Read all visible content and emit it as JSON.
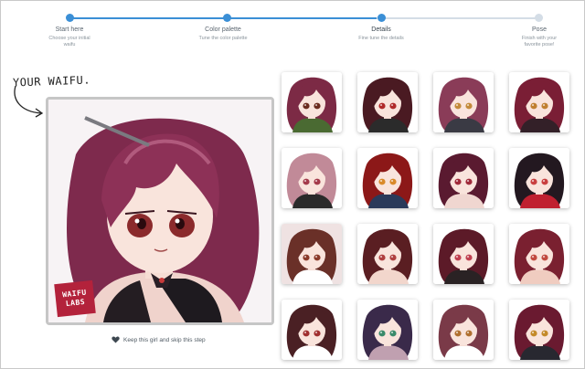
{
  "stepper": {
    "steps": [
      {
        "title": "Start here",
        "description": "Choose your initial waifu"
      },
      {
        "title": "Color palette",
        "description": "Tune the color palette"
      },
      {
        "title": "Details",
        "description": "Fine tune the details",
        "active": true
      },
      {
        "title": "Pose",
        "description": "Finish with your favorite pose!"
      }
    ],
    "accent_color": "#3b8fd6",
    "inactive_color": "#d4dde6"
  },
  "left_panel": {
    "heading": "YOUR WAIFU.",
    "logo_lines": [
      "WAIFU",
      "LABS"
    ],
    "keep_link": "Keep this girl and skip this step",
    "keep_icon": "heart-icon"
  },
  "grid": {
    "columns": 4,
    "tiles": [
      {
        "hair": "#7c2a45",
        "eyes": "#6a2b1e",
        "outfit": "#4a6a32",
        "bg": "#ffffff"
      },
      {
        "hair": "#4a1a22",
        "eyes": "#b02a2a",
        "outfit": "#2b2b2b",
        "bg": "#ffffff"
      },
      {
        "hair": "#8a3c58",
        "eyes": "#c38a3a",
        "outfit": "#3a3a44",
        "bg": "#ffffff"
      },
      {
        "hair": "#7a1e35",
        "eyes": "#c08030",
        "outfit": "#332028",
        "bg": "#ffffff"
      },
      {
        "hair": "#c18a98",
        "eyes": "#a43a4a",
        "outfit": "#2a2a2a",
        "bg": "#ffffff"
      },
      {
        "hair": "#8c1818",
        "eyes": "#d98a2a",
        "outfit": "#2a3a5a",
        "bg": "#ffffff"
      },
      {
        "hair": "#5a1a30",
        "eyes": "#a02a3a",
        "outfit": "#f0d6d0",
        "bg": "#ffffff"
      },
      {
        "hair": "#231820",
        "eyes": "#c94040",
        "outfit": "#c02030",
        "bg": "#ffffff"
      },
      {
        "hair": "#6a3028",
        "eyes": "#8a3a2a",
        "outfit": "#ffffff",
        "bg": "#efe2e2"
      },
      {
        "hair": "#5a1e22",
        "eyes": "#b04040",
        "outfit": "#f2d6cc",
        "bg": "#ffffff"
      },
      {
        "hair": "#5c1a28",
        "eyes": "#c04050",
        "outfit": "#2a2224",
        "bg": "#ffffff"
      },
      {
        "hair": "#7a2030",
        "eyes": "#c24a40",
        "outfit": "#f0ccc0",
        "bg": "#ffffff"
      },
      {
        "hair": "#4a2024",
        "eyes": "#a03030",
        "outfit": "#ffffff",
        "bg": "#ffffff"
      },
      {
        "hair": "#3a2a4a",
        "eyes": "#3a8a6a",
        "outfit": "#c0a0b0",
        "bg": "#ffffff"
      },
      {
        "hair": "#7a3a48",
        "eyes": "#b07030",
        "outfit": "#ffffff",
        "bg": "#ffffff"
      },
      {
        "hair": "#6a1a30",
        "eyes": "#c48a2a",
        "outfit": "#282830",
        "bg": "#ffffff"
      }
    ]
  }
}
